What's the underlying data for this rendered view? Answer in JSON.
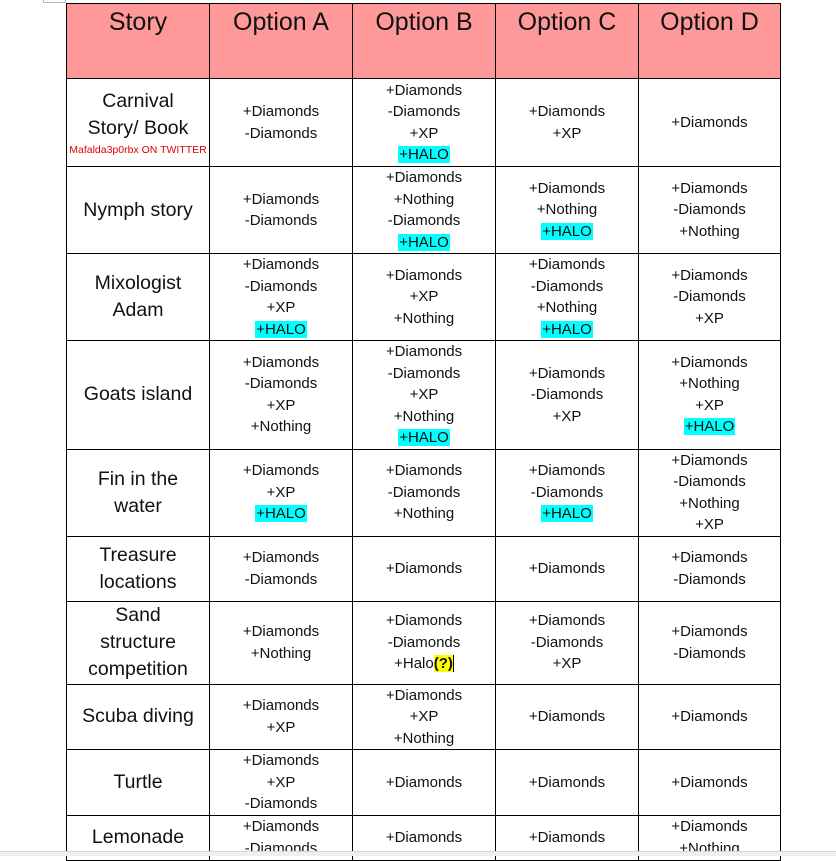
{
  "colors": {
    "header_bg": "#ff9999",
    "halo_highlight": "#00ffff",
    "question_highlight": "#ffff00",
    "credit_text": "#e00000"
  },
  "header": [
    "Story",
    "Option A",
    "Option B",
    "Option C",
    "Option D"
  ],
  "credit": "Mafalda3p0rbx ON TWITTER",
  "rows": [
    {
      "story": "Carnival Story/ Book",
      "options": [
        [
          "+Diamonds",
          "-Diamonds"
        ],
        [
          "+Diamonds",
          "-Diamonds",
          "+XP",
          "+HALO"
        ],
        [
          "+Diamonds",
          "+XP"
        ],
        [
          "+Diamonds"
        ]
      ]
    },
    {
      "story": "Nymph story",
      "options": [
        [
          "+Diamonds",
          "-Diamonds"
        ],
        [
          "+Diamonds",
          "+Nothing",
          "-Diamonds",
          "+HALO"
        ],
        [
          "+Diamonds",
          "+Nothing",
          "+HALO"
        ],
        [
          "+Diamonds",
          "-Diamonds",
          "+Nothing"
        ]
      ]
    },
    {
      "story": "Mixologist Adam",
      "options": [
        [
          "+Diamonds",
          "-Diamonds",
          "+XP",
          "+HALO"
        ],
        [
          "+Diamonds",
          "+XP",
          "+Nothing"
        ],
        [
          "+Diamonds",
          "-Diamonds",
          "+Nothing",
          "+HALO"
        ],
        [
          "+Diamonds",
          "-Diamonds",
          "+XP"
        ]
      ]
    },
    {
      "story": "Goats island",
      "options": [
        [
          "+Diamonds",
          "-Diamonds",
          "+XP",
          "+Nothing"
        ],
        [
          "+Diamonds",
          "-Diamonds",
          "+XP",
          "+Nothing",
          "+HALO"
        ],
        [
          "+Diamonds",
          "-Diamonds",
          "+XP"
        ],
        [
          "+Diamonds",
          "+Nothing",
          "+XP",
          "+HALO"
        ]
      ]
    },
    {
      "story": "Fin in the water",
      "options": [
        [
          "+Diamonds",
          "+XP",
          "+HALO"
        ],
        [
          "+Diamonds",
          "-Diamonds",
          "+Nothing"
        ],
        [
          "+Diamonds",
          "-Diamonds",
          "+HALO"
        ],
        [
          "+Diamonds",
          "-Diamonds",
          "+Nothing",
          "+XP"
        ]
      ]
    },
    {
      "story": "Treasure locations",
      "options": [
        [
          "+Diamonds",
          "-Diamonds"
        ],
        [
          "+Diamonds"
        ],
        [
          "+Diamonds"
        ],
        [
          "+Diamonds",
          "-Diamonds"
        ]
      ]
    },
    {
      "story": "Sand structure competition",
      "options": [
        [
          "+Diamonds",
          "+Nothing"
        ],
        [
          "+Diamonds",
          "-Diamonds",
          "+Halo(?)"
        ],
        [
          "+Diamonds",
          "-Diamonds",
          "+XP"
        ],
        [
          "+Diamonds",
          "-Diamonds"
        ]
      ]
    },
    {
      "story": "Scuba diving",
      "options": [
        [
          "+Diamonds",
          "+XP"
        ],
        [
          "+Diamonds",
          "+XP",
          "+Nothing"
        ],
        [
          "+Diamonds"
        ],
        [
          "+Diamonds"
        ]
      ]
    },
    {
      "story": "Turtle",
      "options": [
        [
          "+Diamonds",
          "+XP",
          "-Diamonds"
        ],
        [
          "+Diamonds"
        ],
        [
          "+Diamonds"
        ],
        [
          "+Diamonds"
        ]
      ]
    },
    {
      "story": "Lemonade",
      "options": [
        [
          "+Diamonds",
          "-Diamonds"
        ],
        [
          "+Diamonds"
        ],
        [
          "+Diamonds"
        ],
        [
          "+Diamonds",
          "+Nothing"
        ]
      ]
    }
  ]
}
